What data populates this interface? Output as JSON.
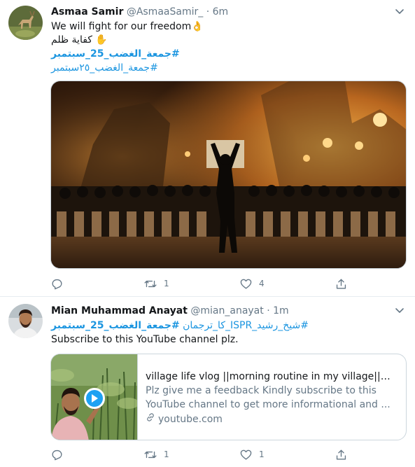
{
  "tweets": [
    {
      "author_name": "Asmaa Samir",
      "author_handle": "@AsmaaSamir_",
      "separator": "·",
      "time": "6m",
      "lines": [
        "We will fight for our freedom👌",
        "✋ كفاية ظلم"
      ],
      "hashtags": [
        "#جمعة_الغضب_25_سبتمبر",
        "#جمعة_الغضب_٢٥سبتمبر"
      ],
      "stats": {
        "replies": "",
        "retweets": "1",
        "likes": "4"
      }
    },
    {
      "author_name": "Mian Muhammad Anayat",
      "author_handle": "@mian_anayat",
      "separator": "·",
      "time": "1m",
      "hashtag_line": [
        "#جمعة_الغضب_25_سبتمبر",
        "#شیخ_رشید_ISPR_کا_ترجمان"
      ],
      "text": "Subscribe to this YouTube channel plz.",
      "card": {
        "title": "village life vlog ||morning routine in my village||صورت...",
        "description_line1": "Plz give me a feedback Kindly subscribe to this",
        "description_line2": "YouTube channel to get more informational and ...",
        "domain": "youtube.com"
      },
      "stats": {
        "replies": "",
        "retweets": "1",
        "likes": "1"
      }
    }
  ],
  "icons": {
    "reply": "reply-icon",
    "retweet": "retweet-icon",
    "like": "heart-icon",
    "share": "share-icon",
    "caret": "chevron-down-icon",
    "link": "link-icon",
    "play": "play-icon"
  },
  "colors": {
    "hashtag": "#1b95e0",
    "secondary_text": "#657786",
    "border": "#e6ecf0",
    "play_button": "#1da1f2"
  }
}
